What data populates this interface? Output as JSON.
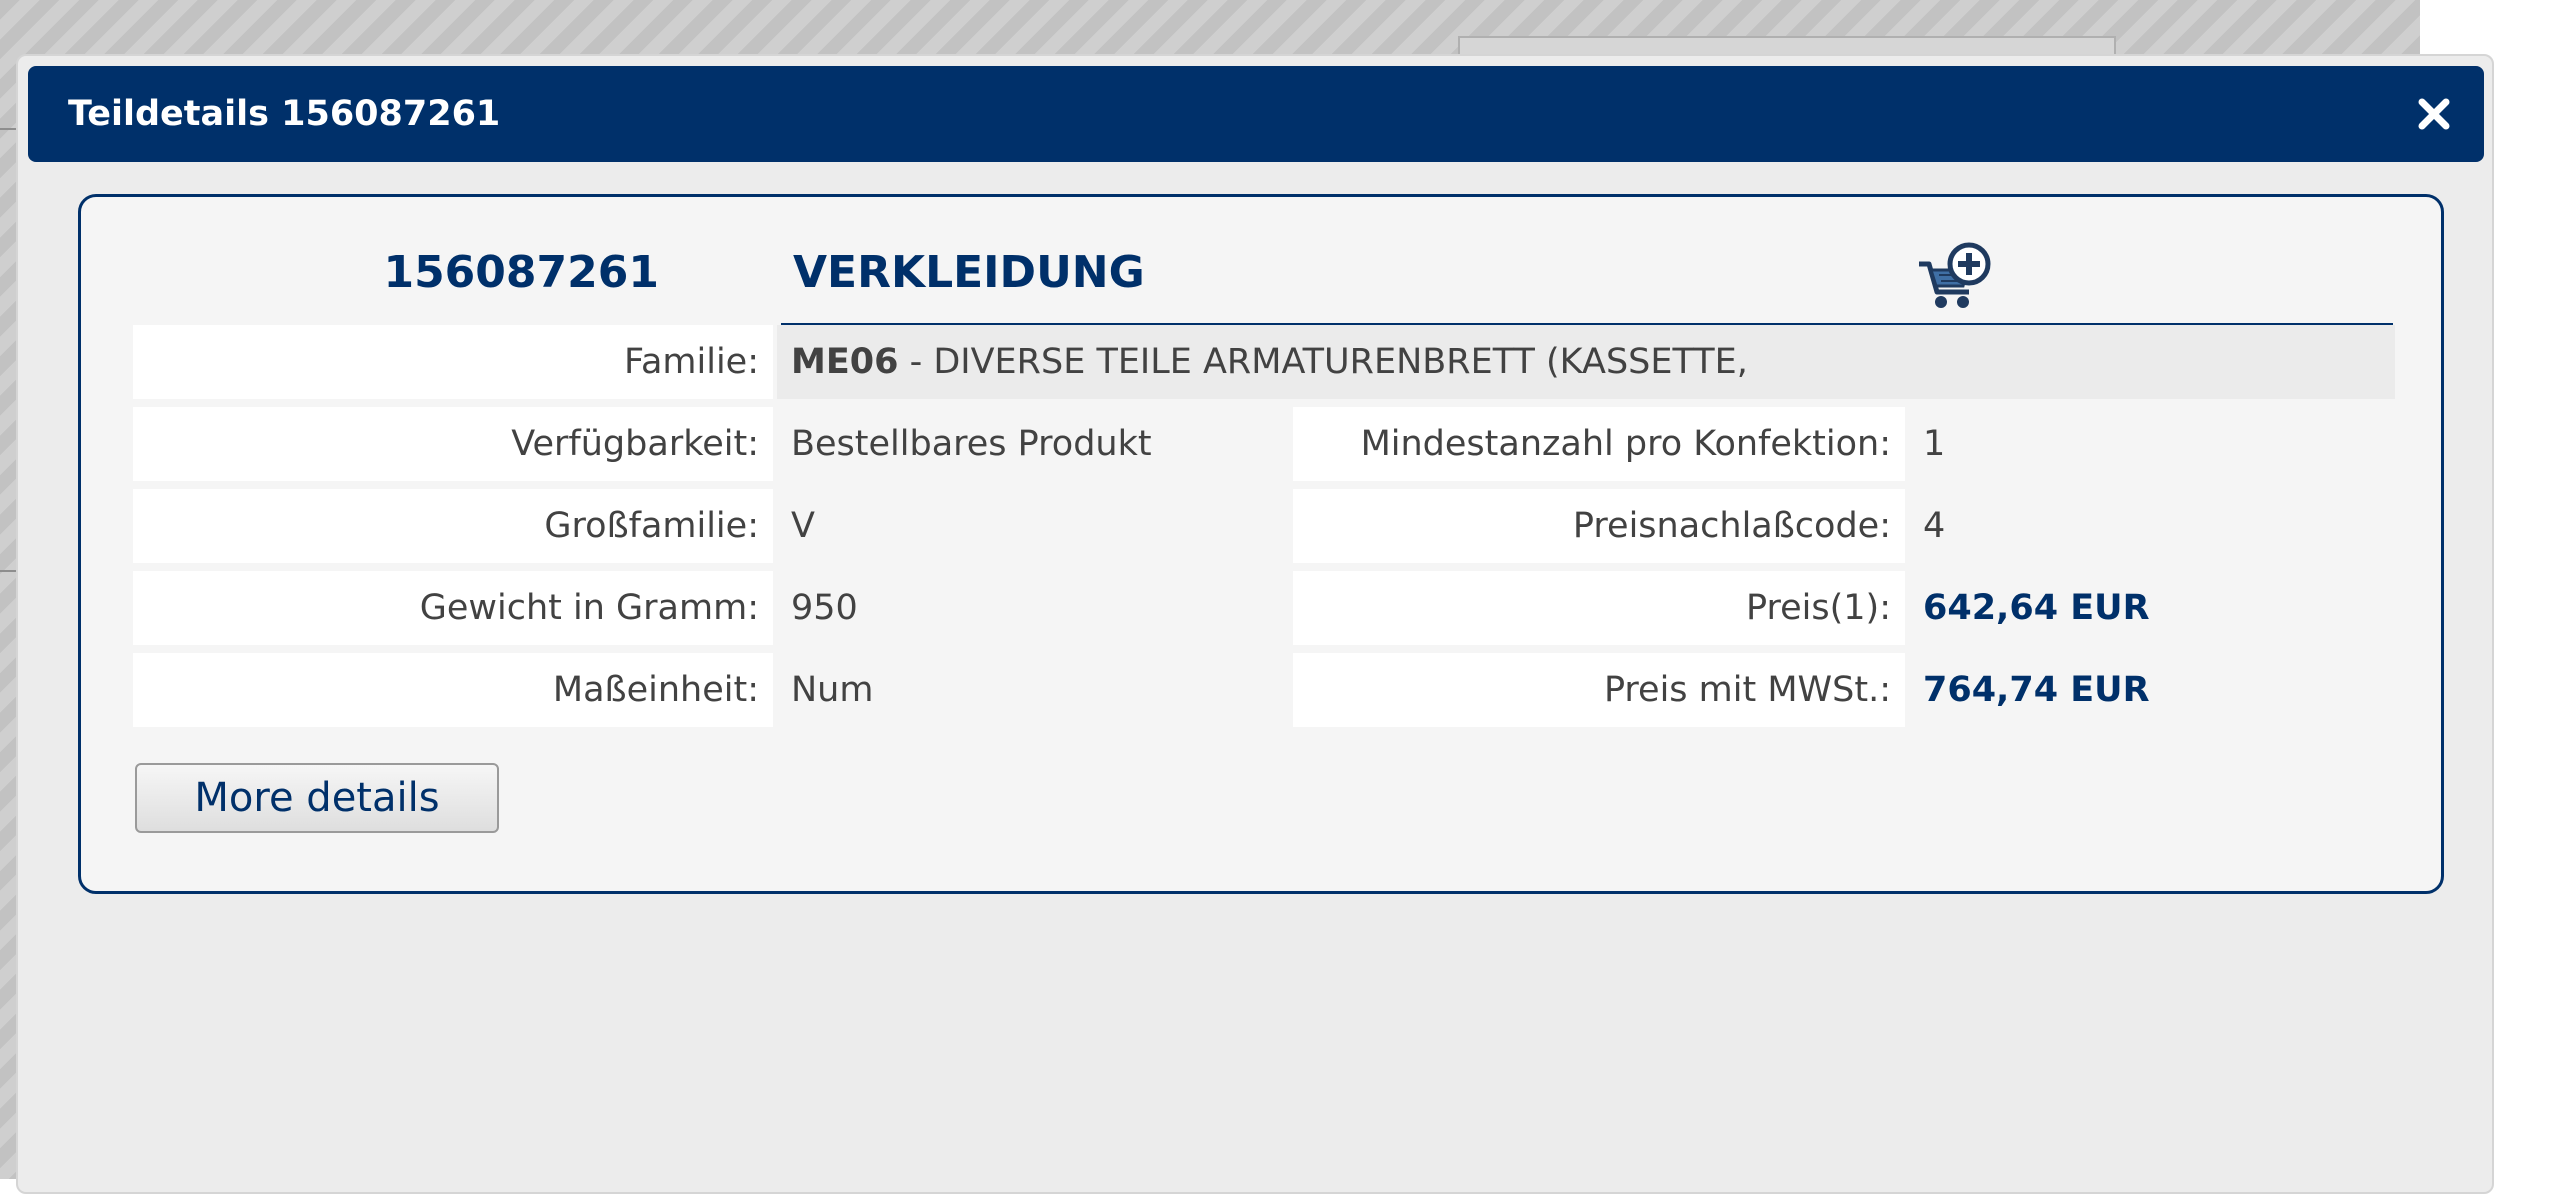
{
  "modal": {
    "title": "Teildetails 156087261",
    "close_icon": "close-icon"
  },
  "part": {
    "number": "156087261",
    "name": "VERKLEIDUNG",
    "cart_icon": "add-to-cart-icon"
  },
  "details": {
    "familie": {
      "label": "Familie:",
      "code": "ME06",
      "description": " - DIVERSE TEILE ARMATURENBRETT (KASSETTE,"
    },
    "left": [
      {
        "label": "Verfügbarkeit:",
        "value": "Bestellbares Produkt"
      },
      {
        "label": "Großfamilie:",
        "value": "V"
      },
      {
        "label": "Gewicht in Gramm:",
        "value": "950"
      },
      {
        "label": "Maßeinheit:",
        "value": "Num"
      }
    ],
    "right": [
      {
        "label": "Mindestanzahl pro Konfektion:",
        "value": "1"
      },
      {
        "label": "Preisnachlaßcode:",
        "value": "4"
      },
      {
        "label": "Preis(1):",
        "value": "642,64 EUR"
      },
      {
        "label": "Preis mit MWSt.:",
        "value": "764,74 EUR"
      }
    ]
  },
  "actions": {
    "more_details": "More details"
  },
  "colors": {
    "header_bg": "#00306a",
    "accent": "#00306a",
    "text": "#424242"
  }
}
